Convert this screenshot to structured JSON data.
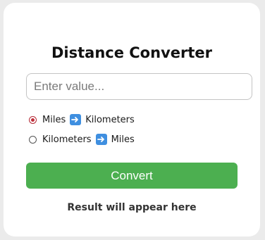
{
  "app": {
    "title": "Distance Converter"
  },
  "input": {
    "placeholder": "Enter value...",
    "value": ""
  },
  "options": [
    {
      "from": "Miles",
      "to": "Kilometers",
      "selected": true,
      "icon": "right-arrow-icon"
    },
    {
      "from": "Kilometers",
      "to": "Miles",
      "selected": false,
      "icon": "right-arrow-icon"
    }
  ],
  "button": {
    "label": "Convert"
  },
  "result": {
    "text": "Result will appear here"
  },
  "colors": {
    "accent": "#4caf50",
    "radio_selected": "#c0303c",
    "arrow_icon": "#3f8fe0"
  }
}
